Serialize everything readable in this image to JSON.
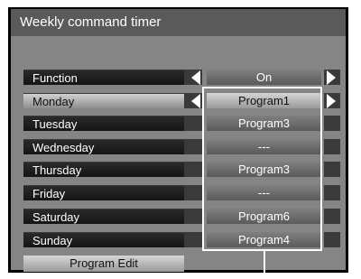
{
  "window": {
    "title": "Weekly command timer"
  },
  "rows": [
    {
      "label": "Function",
      "value": "On"
    },
    {
      "label": "Monday",
      "value": "Program1"
    },
    {
      "label": "Tuesday",
      "value": "Program3"
    },
    {
      "label": "Wednesday",
      "value": "---"
    },
    {
      "label": "Thursday",
      "value": "Program3"
    },
    {
      "label": "Friday",
      "value": "---"
    },
    {
      "label": "Saturday",
      "value": "Program6"
    },
    {
      "label": "Sunday",
      "value": "Program4"
    }
  ],
  "actions": {
    "program_edit_label": "Program Edit"
  },
  "icons": {
    "left_arrow": "left-arrow-icon",
    "right_arrow": "right-arrow-icon"
  },
  "colors": {
    "panel": "#000000",
    "title_bg": "#5a5a5a",
    "content_bg": "#858585",
    "selected_row": "#bdbdbd",
    "text": "#ffffff"
  }
}
